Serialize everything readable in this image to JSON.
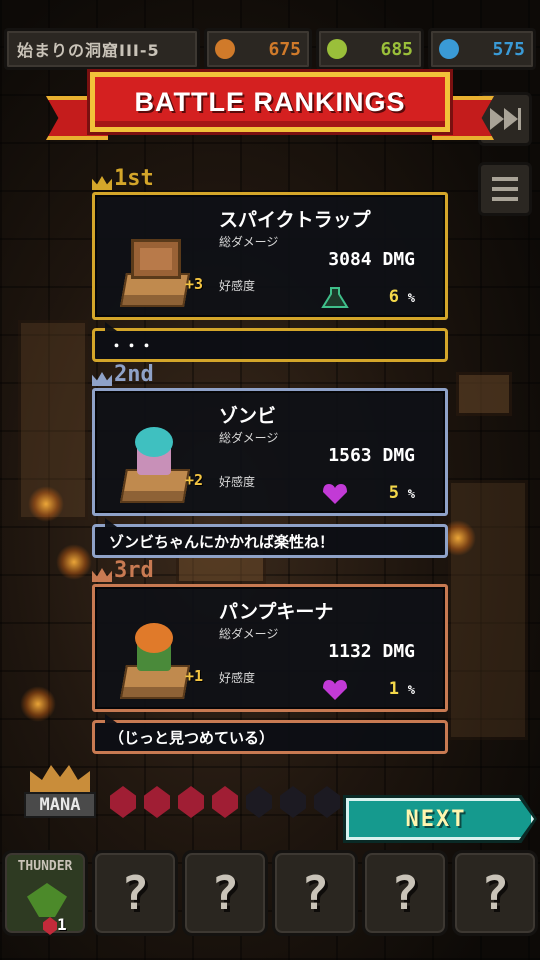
{
  "topbar": {
    "stage": "始まりの洞窟III-5",
    "resources": [
      {
        "icon": "orange-coin-icon",
        "color": "#d07a2a",
        "value": "675"
      },
      {
        "icon": "green-bag-icon",
        "color": "#9abf3a",
        "value": "685"
      },
      {
        "icon": "blue-heart-icon",
        "color": "#3a9ad6",
        "value": "575"
      }
    ]
  },
  "banner": {
    "title": "BATTLE RANKINGS"
  },
  "rankings": [
    {
      "rank": "1st",
      "color": "#d4a62a",
      "name": "スパイクトラップ",
      "damage_label": "総ダメージ",
      "damage": "3084 DMG",
      "affinity_label": "好感度",
      "affinity_icon": "green-flask-icon",
      "affinity": "6",
      "affinity_unit": "%",
      "level_bonus": "+3",
      "quote": "・・・"
    },
    {
      "rank": "2nd",
      "color": "#8fa2c8",
      "name": "ゾンビ",
      "damage_label": "総ダメージ",
      "damage": "1563 DMG",
      "affinity_label": "好感度",
      "affinity_icon": "purple-heart-icon",
      "affinity": "5",
      "affinity_unit": "%",
      "level_bonus": "+2",
      "quote": "ゾンビちゃんにかかれば楽性ね！"
    },
    {
      "rank": "3rd",
      "color": "#c87a52",
      "name": "パンプキーナ",
      "damage_label": "総ダメージ",
      "damage": "1132 DMG",
      "affinity_label": "好感度",
      "affinity_icon": "purple-heart-icon",
      "affinity": "1",
      "affinity_unit": "%",
      "level_bonus": "+1",
      "quote": "（じっと見つめている）"
    }
  ],
  "mana": {
    "label": "MANA",
    "gems_filled": 4,
    "gems_total": 7
  },
  "next_button": {
    "label": "NEXT"
  },
  "skills": {
    "thunder": {
      "label": "THUNDER",
      "cost": "1"
    },
    "locked_symbol": "?"
  }
}
